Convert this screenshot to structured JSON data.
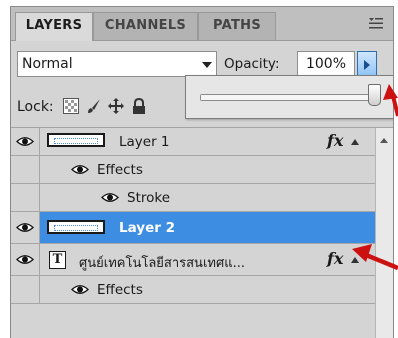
{
  "tabs": [
    {
      "label": "LAYERS",
      "active": true
    },
    {
      "label": "CHANNELS",
      "active": false
    },
    {
      "label": "PATHS",
      "active": false
    }
  ],
  "blend": {
    "mode": "Normal",
    "opacity_label": "Opacity:",
    "opacity_value": "100%"
  },
  "opacity_slider": {
    "value_percent": 100
  },
  "lock": {
    "label": "Lock:",
    "icons": [
      "lock-transparent-icon",
      "lock-paint-icon",
      "lock-move-icon",
      "lock-all-icon"
    ]
  },
  "layers": [
    {
      "name": "Layer 1",
      "visible": true,
      "has_fx": true,
      "kind": "pixel"
    },
    {
      "name": "Effects",
      "kind": "effects-group"
    },
    {
      "name": "Stroke",
      "kind": "effect"
    },
    {
      "name": "Layer 2",
      "visible": true,
      "selected": true,
      "kind": "pixel"
    },
    {
      "name": "ศูนย์เทคโนโลยีสารสนเทศแ...",
      "visible": true,
      "has_fx": true,
      "kind": "text"
    },
    {
      "name": "Effects",
      "kind": "effects-group"
    }
  ],
  "colors": {
    "selection": "#3d8ee3",
    "annotation_arrow": "#cc1111",
    "panel": "#d4d4d4"
  }
}
